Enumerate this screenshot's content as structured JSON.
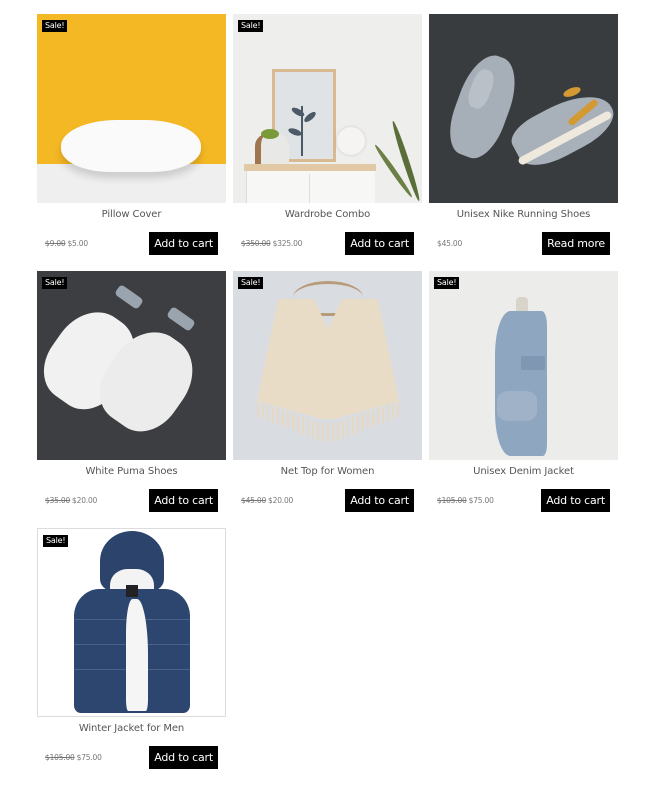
{
  "sale_badge": "Sale!",
  "products": [
    {
      "name": "Pillow Cover",
      "old_price": "$9.00",
      "price": "$5.00",
      "button": "Add to cart",
      "on_sale": true
    },
    {
      "name": "Wardrobe Combo",
      "old_price": "$350.00",
      "price": "$325.00",
      "button": "Add to cart",
      "on_sale": true
    },
    {
      "name": "Unisex Nike Running Shoes",
      "old_price": "",
      "price": "$45.00",
      "button": "Read more",
      "on_sale": false
    },
    {
      "name": "White Puma Shoes",
      "old_price": "$35.00",
      "price": "$20.00",
      "button": "Add to cart",
      "on_sale": true
    },
    {
      "name": "Net Top for Women",
      "old_price": "$45.00",
      "price": "$20.00",
      "button": "Add to cart",
      "on_sale": true
    },
    {
      "name": "Unisex Denim Jacket",
      "old_price": "$105.00",
      "price": "$75.00",
      "button": "Add to cart",
      "on_sale": true
    },
    {
      "name": "Winter Jacket for Men",
      "old_price": "$105.00",
      "price": "$75.00",
      "button": "Add to cart",
      "on_sale": true
    }
  ],
  "colors": {
    "button_bg": "#000000",
    "button_text": "#ffffff",
    "badge_bg": "#000000"
  }
}
